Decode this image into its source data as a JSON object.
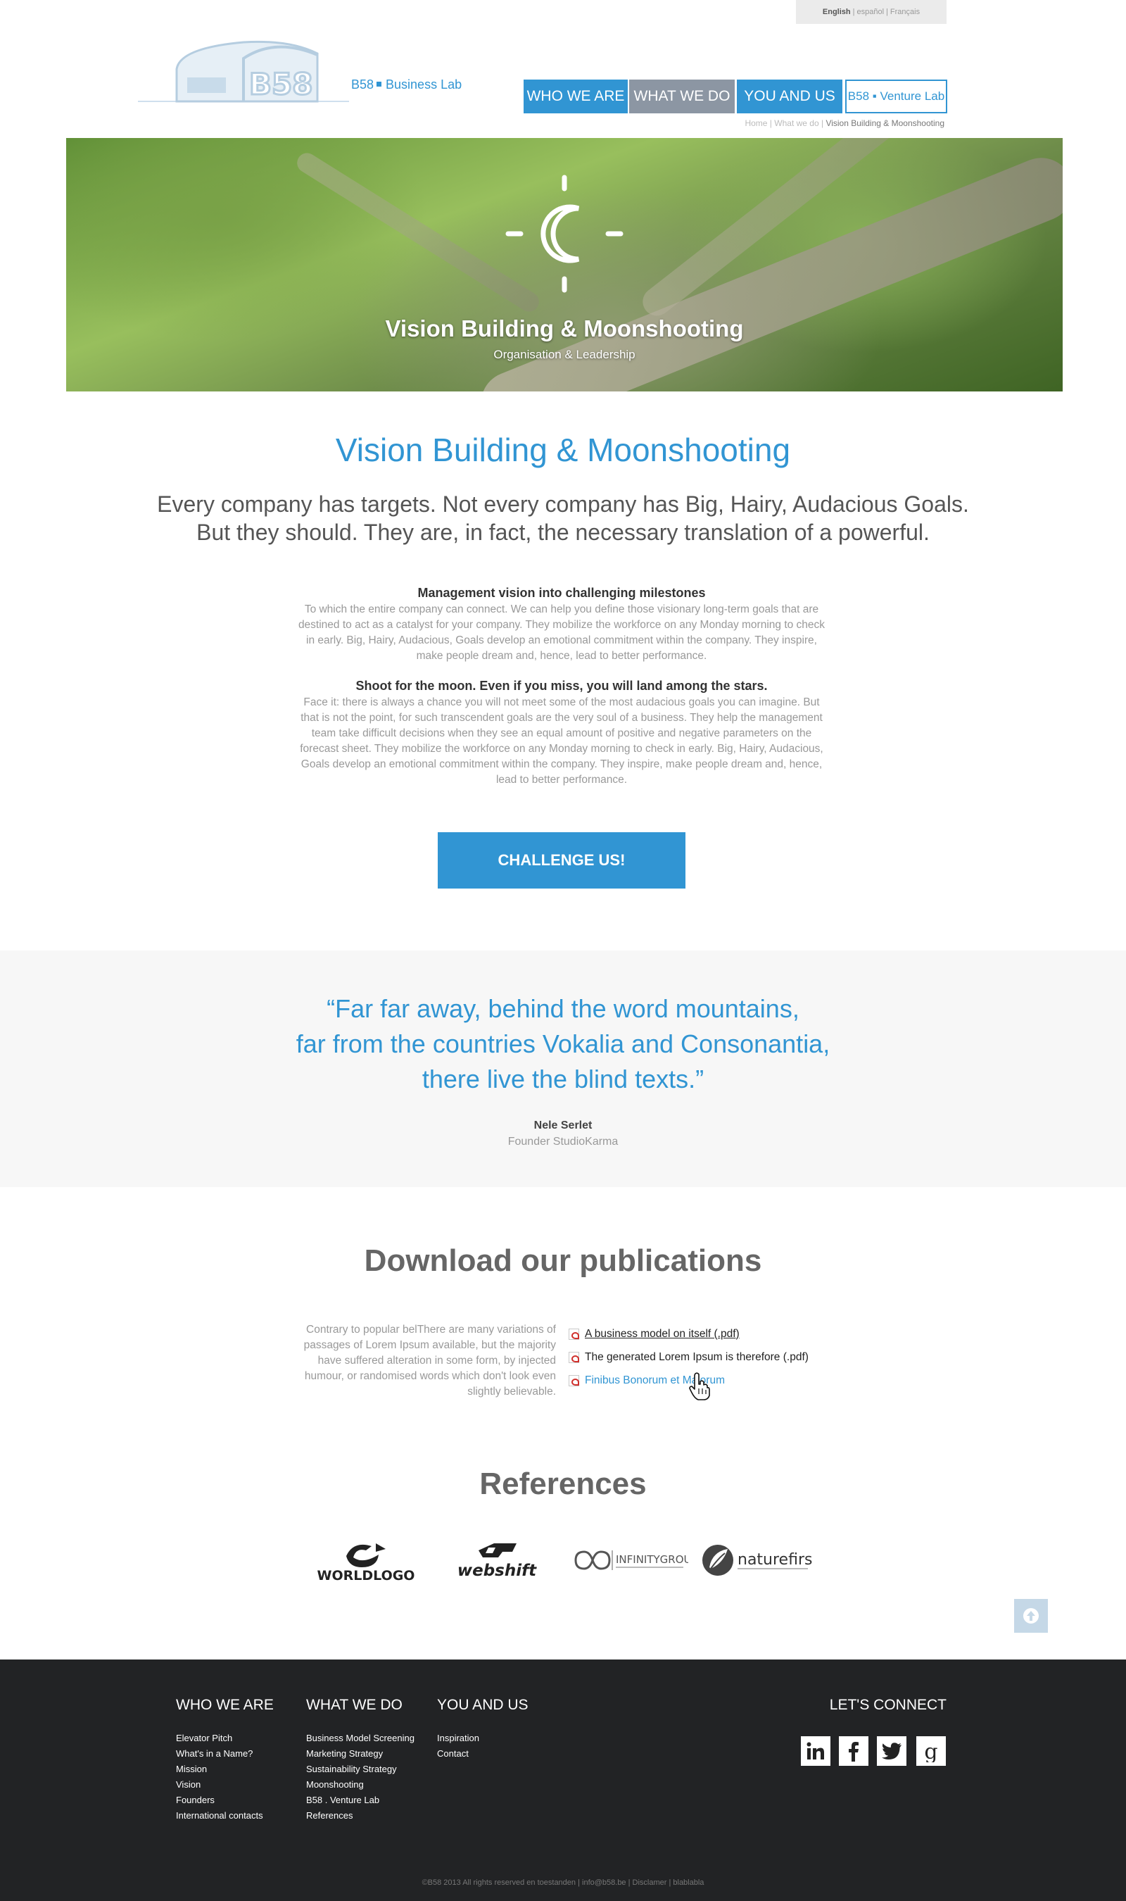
{
  "lang": {
    "current": "English",
    "others": [
      "español",
      "Français"
    ]
  },
  "brand": {
    "logo_alt": "B58",
    "name_left": "B58",
    "name_right": "Business Lab"
  },
  "nav": {
    "who": "WHO WE ARE",
    "what": "WHAT WE DO",
    "you": "YOU AND US",
    "venture": "B58 ▪ Venture Lab"
  },
  "breadcrumb": {
    "home": "Home",
    "section": "What we do",
    "current": "Vision Building & Moonshooting"
  },
  "hero": {
    "title": "Vision Building & Moonshooting",
    "subtitle": "Organisation & Leadership"
  },
  "intro": {
    "title": "Vision Building & Moonshooting",
    "lead": "Every company has targets. Not every company has Big, Hairy, Audacious Goals. But they should. They are, in fact, the necessary translation of a powerful.",
    "block1_heading": "Management vision into challenging milestones",
    "block1_text": "To which the entire company can connect. We can help you define those visionary long-term goals that are destined to act as a catalyst for your company. They mobilize the workforce on any Monday morning to check in early. Big, Hairy, Audacious, Goals develop an emotional commitment within the company. They inspire, make people dream and, hence, lead to better performance.",
    "block2_heading": "Shoot for the moon. Even if you miss, you will land among the stars.",
    "block2_text": "Face it: there is always a chance you will not meet some of the most audacious goals you can imagine. But that is not the point, for such transcendent goals are the very soul of a business. They help the management team take difficult decisions when they see an equal amount of positive and negative parameters on the forecast sheet. They mobilize the workforce on any Monday morning to check in early. Big, Hairy, Audacious, Goals develop an emotional commitment within the company. They inspire, make people dream and, hence, lead to better performance.",
    "cta": "CHALLENGE US!"
  },
  "quote": {
    "line1": "“Far far away, behind the word mountains,",
    "line2": "far from the countries Vokalia and Consonantia,",
    "line3": "there live the blind texts.”",
    "author": "Nele Serlet",
    "role": "Founder StudioKarma"
  },
  "publications": {
    "title": "Download our publications",
    "text": "Contrary to popular belThere are many variations of passages of Lorem Ipsum available, but the majority have suffered alteration in some form, by injected humour, or randomised words which don't look even slightly believable.",
    "items": [
      "A business model on itself (.pdf)",
      "The generated Lorem Ipsum is therefore (.pdf)",
      "Finibus Bonorum et Malorum"
    ]
  },
  "references": {
    "title": "References",
    "logos": [
      "WORLDLOGO",
      "webshift",
      "INFINITYGROUP",
      "naturefirst"
    ]
  },
  "footer": {
    "who": {
      "title": "WHO WE ARE",
      "links": [
        "Elevator Pitch",
        "What's in a Name?",
        "Mission",
        "Vision",
        "Founders",
        "International contacts"
      ]
    },
    "what": {
      "title": "WHAT WE DO",
      "links": [
        "Business Model Screening",
        "Marketing Strategy",
        "Sustainability Strategy",
        "Moonshooting",
        "B58 . Venture Lab",
        "References"
      ]
    },
    "you": {
      "title": "YOU AND US",
      "links": [
        "Inspiration",
        "Contact"
      ]
    },
    "connect": "LET'S CONNECT",
    "copyright": "©B58 2013 All rights reserved en toestanden | info@b58.be | Disclamer | blablabla"
  },
  "colors": {
    "accent": "#3195d3",
    "nav_active": "#8c96a3",
    "footer_bg": "#222325"
  }
}
